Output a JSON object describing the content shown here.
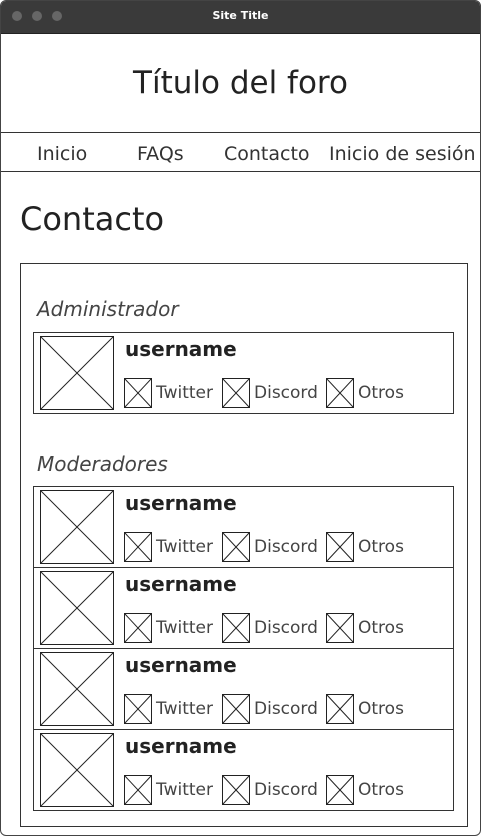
{
  "window": {
    "title": "Site Title"
  },
  "header": {
    "forum_title": "Título del foro"
  },
  "nav": {
    "items": [
      {
        "label": "Inicio"
      },
      {
        "label": "FAQs"
      },
      {
        "label": "Contacto"
      },
      {
        "label": "Inicio de sesión"
      }
    ]
  },
  "main": {
    "heading": "Contacto",
    "admin_section": {
      "label": "Administrador",
      "members": [
        {
          "username": "username",
          "links": [
            "Twitter",
            "Discord",
            "Otros"
          ]
        }
      ]
    },
    "mod_section": {
      "label": "Moderadores",
      "members": [
        {
          "username": "username",
          "links": [
            "Twitter",
            "Discord",
            "Otros"
          ]
        },
        {
          "username": "username",
          "links": [
            "Twitter",
            "Discord",
            "Otros"
          ]
        },
        {
          "username": "username",
          "links": [
            "Twitter",
            "Discord",
            "Otros"
          ]
        },
        {
          "username": "username",
          "links": [
            "Twitter",
            "Discord",
            "Otros"
          ]
        }
      ]
    }
  },
  "icons": {
    "avatar": "image-placeholder-icon",
    "social": "image-placeholder-icon"
  }
}
